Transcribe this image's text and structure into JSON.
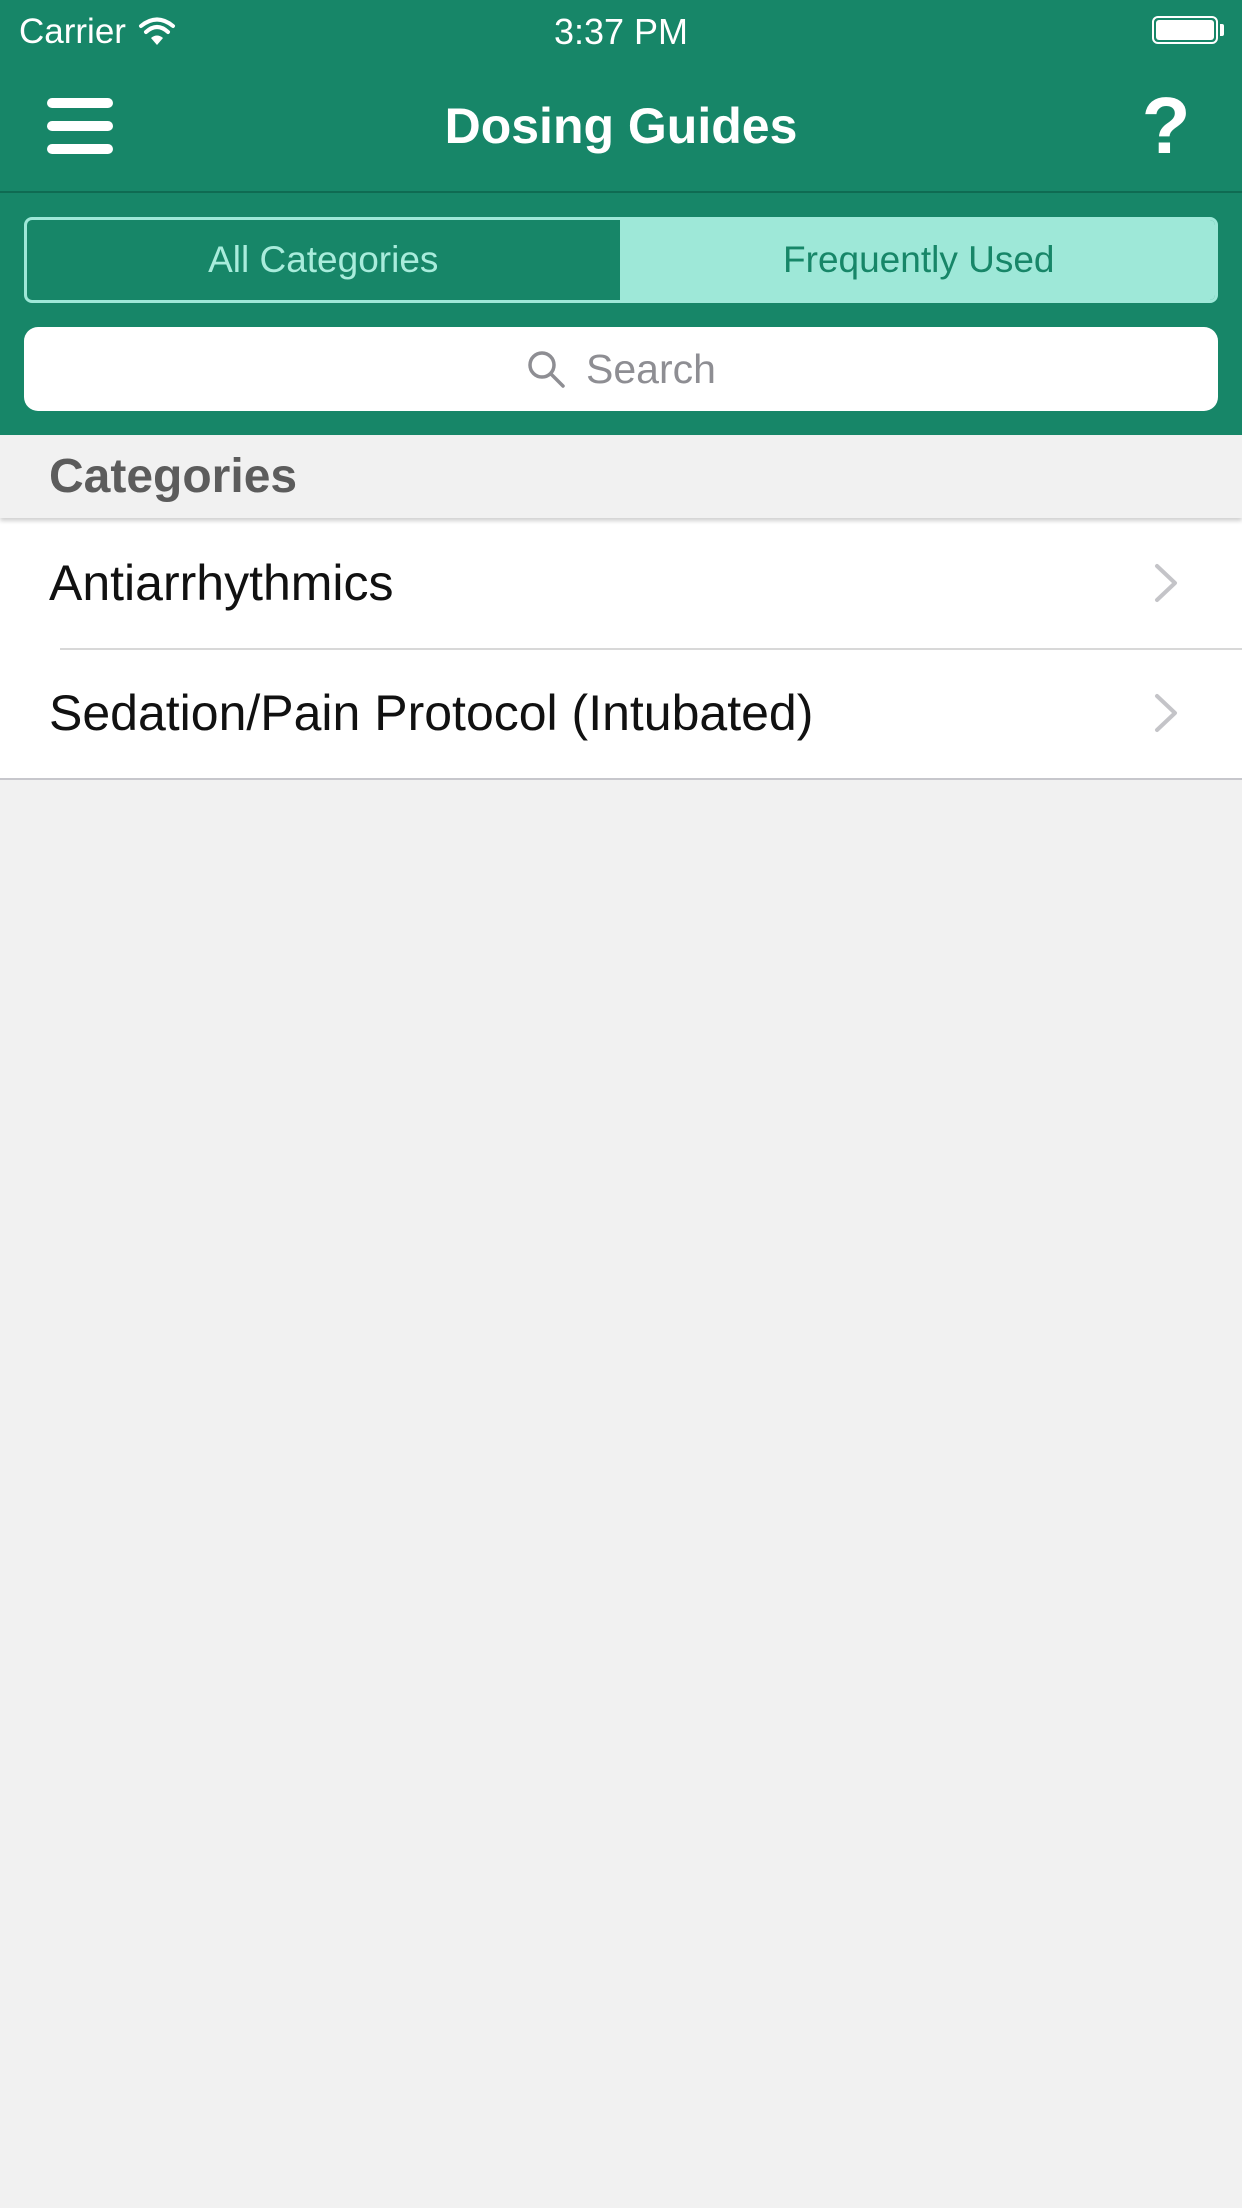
{
  "status_bar": {
    "carrier": "Carrier",
    "time": "3:37 PM",
    "wifi_icon": "wifi-icon",
    "battery_icon": "battery-icon"
  },
  "nav": {
    "title": "Dosing Guides",
    "menu_icon": "hamburger-menu-icon",
    "help_label": "?"
  },
  "segments": {
    "all_label": "All Categories",
    "frequent_label": "Frequently Used",
    "selected": "Frequently Used"
  },
  "search": {
    "placeholder": "Search",
    "icon": "search-icon"
  },
  "section": {
    "title": "Categories"
  },
  "categories": [
    {
      "label": "Antiarrhythmics",
      "icon": "chevron-right-icon"
    },
    {
      "label": "Sedation/Pain Protocol (Intubated)",
      "icon": "chevron-right-icon"
    }
  ],
  "colors": {
    "brand": "#178668",
    "segment_accent": "#9ee8d8",
    "background": "#f1f1f1"
  }
}
